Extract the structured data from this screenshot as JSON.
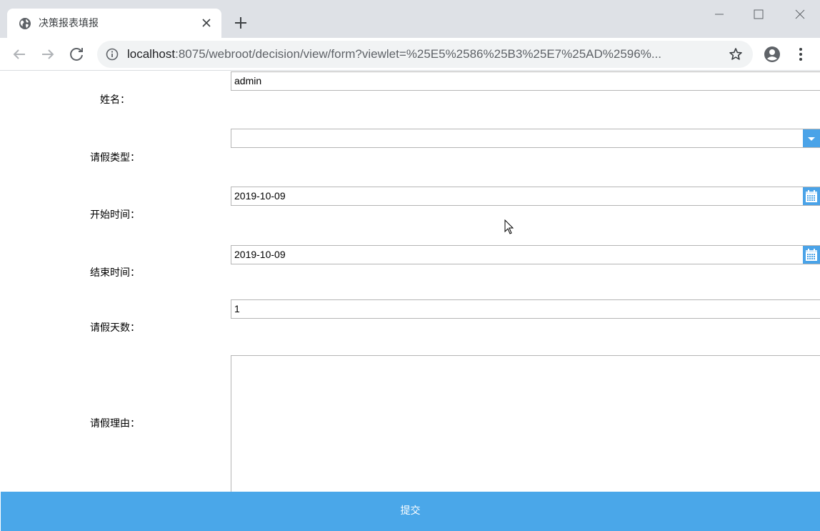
{
  "browser": {
    "tab_title": "决策报表填报",
    "url_host": "localhost",
    "url_rest": ":8075/webroot/decision/view/form?viewlet=%25E5%2586%25B3%25E7%25AD%2596%..."
  },
  "form": {
    "name_label": "姓名：",
    "name_value": "admin",
    "leave_type_label": "请假类型：",
    "leave_type_value": "",
    "start_label": "开始时间：",
    "start_value": "2019-10-09",
    "end_label": "结束时间：",
    "end_value": "2019-10-09",
    "days_label": "请假天数：",
    "days_value": "1",
    "reason_label": "请假理由：",
    "reason_value": "",
    "submit_label": "提交"
  },
  "colors": {
    "accent": "#4aa7e9",
    "tabstrip": "#dee1e6"
  }
}
